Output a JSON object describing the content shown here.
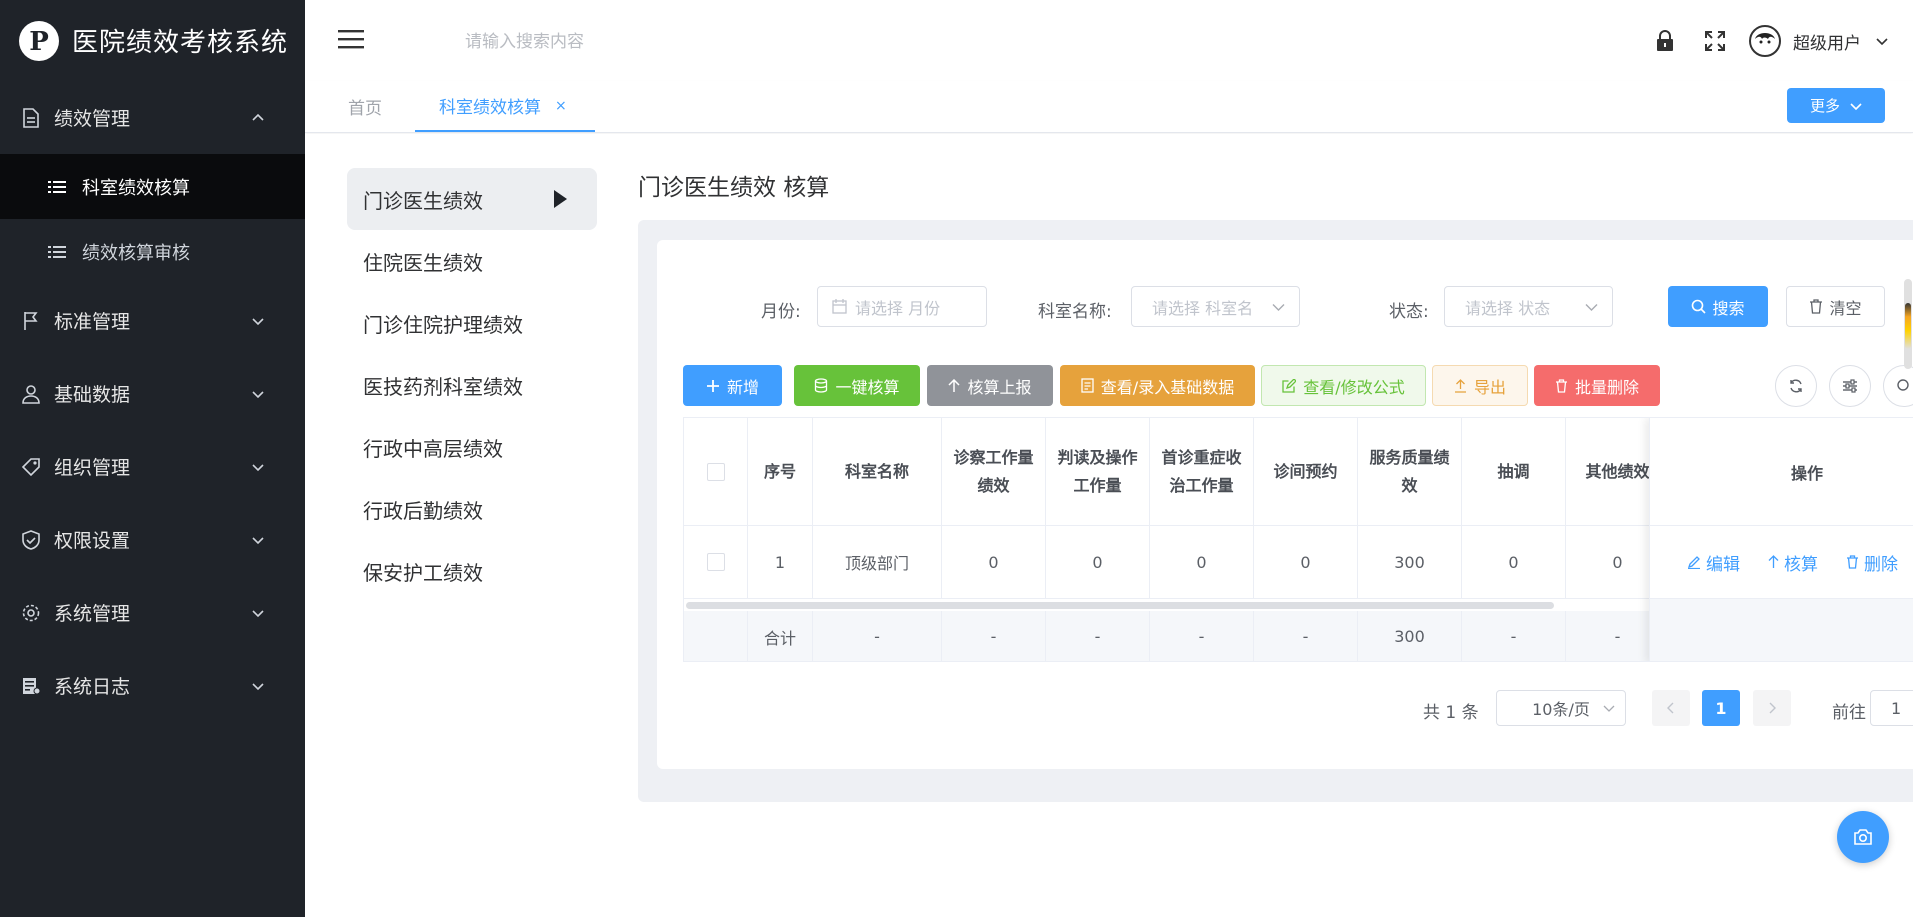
{
  "app": {
    "title": "医院绩效考核系统"
  },
  "sidebar": {
    "groups": [
      {
        "label": "绩效管理",
        "icon": "document-icon",
        "expanded": true,
        "children": [
          {
            "label": "科室绩效核算",
            "active": true
          },
          {
            "label": "绩效核算审核",
            "active": false
          }
        ]
      },
      {
        "label": "标准管理",
        "icon": "flag-icon"
      },
      {
        "label": "基础数据",
        "icon": "user-icon"
      },
      {
        "label": "组织管理",
        "icon": "tag-icon"
      },
      {
        "label": "权限设置",
        "icon": "shield-check-icon"
      },
      {
        "label": "系统管理",
        "icon": "gear-icon"
      },
      {
        "label": "系统日志",
        "icon": "log-icon"
      }
    ]
  },
  "topbar": {
    "search_placeholder": "请输入搜索内容",
    "user_name": "超级用户"
  },
  "tabs": {
    "items": [
      {
        "label": "首页",
        "active": false
      },
      {
        "label": "科室绩效核算",
        "active": true
      }
    ],
    "close_glyph": "×",
    "more_label": "更多"
  },
  "left_list": {
    "items": [
      {
        "label": "门诊医生绩效",
        "active": true
      },
      {
        "label": "住院医生绩效"
      },
      {
        "label": "门诊住院护理绩效"
      },
      {
        "label": "医技药剂科室绩效"
      },
      {
        "label": "行政中高层绩效"
      },
      {
        "label": "行政后勤绩效"
      },
      {
        "label": "保安护工绩效"
      }
    ]
  },
  "page_title": "门诊医生绩效 核算",
  "filters": {
    "month_label": "月份:",
    "month_placeholder": "请选择 月份",
    "dept_label": "科室名称:",
    "dept_placeholder": "请选择 科室名",
    "status_label": "状态:",
    "status_placeholder": "请选择 状态",
    "search_label": "搜索",
    "clear_label": "清空"
  },
  "toolbar": {
    "add": "新增",
    "one_click": "一键核算",
    "report": "核算上报",
    "view_base": "查看/录入基础数据",
    "view_formula": "查看/修改公式",
    "export": "导出",
    "batch_delete": "批量删除"
  },
  "colors": {
    "primary": "#409eff",
    "success": "#67c23a",
    "info": "#909399",
    "warning": "#e6a23c",
    "danger": "#f56c6c",
    "sidebar_bg": "#1f2329"
  },
  "table": {
    "columns": [
      "序号",
      "科室名称",
      "诊察工作量绩效",
      "判读及操作工作量",
      "首诊重症收治工作量",
      "诊间预约",
      "服务质量绩效",
      "抽调",
      "其他绩效"
    ],
    "ops_header": "操作",
    "rows": [
      [
        "1",
        "顶级部门",
        "0",
        "0",
        "0",
        "0",
        "300",
        "0",
        "0"
      ]
    ],
    "summary": [
      "合计",
      "-",
      "-",
      "-",
      "-",
      "-",
      "300",
      "-",
      "-"
    ],
    "ops": {
      "edit": "编辑",
      "calc": "核算",
      "delete": "删除"
    }
  },
  "pagination": {
    "total": "共 1 条",
    "page_size": "10条/页",
    "current_page": "1",
    "goto_label": "前往",
    "goto_value": "1"
  }
}
